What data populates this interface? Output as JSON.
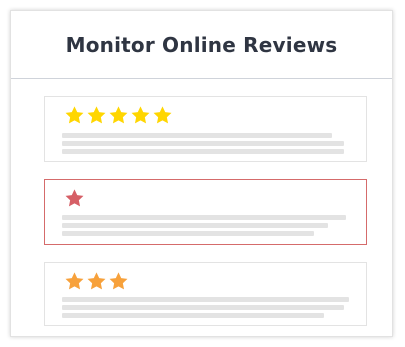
{
  "card": {
    "title": "Monitor Online Reviews"
  },
  "reviews": [
    {
      "rating": 5,
      "star_color": "#ffd600",
      "highlighted": false
    },
    {
      "rating": 1,
      "star_color": "#d65f66",
      "highlighted": true
    },
    {
      "rating": 3,
      "star_color": "#f7a13b",
      "highlighted": false
    }
  ],
  "colors": {
    "highlight_border": "#d56b6b",
    "text_placeholder": "#e3e3e3"
  }
}
